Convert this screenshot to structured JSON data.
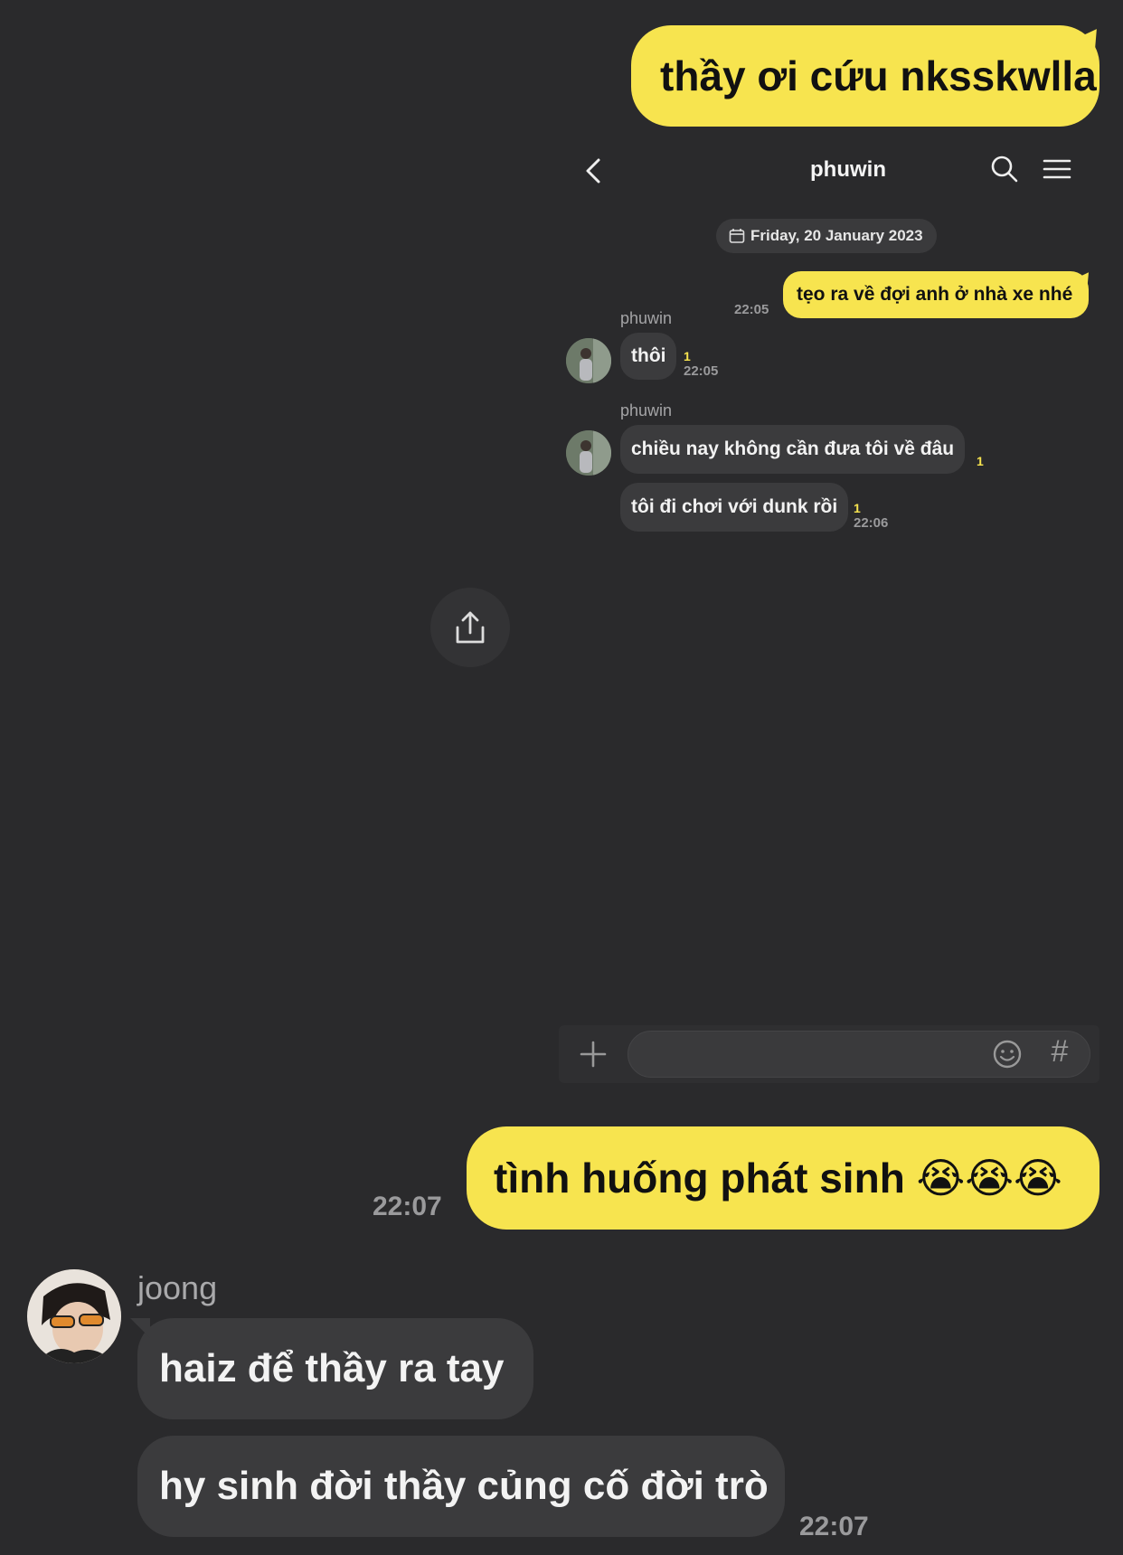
{
  "outer_chat": {
    "top_message": "thầy ơi cứu nksskwlla",
    "second_message": "tình huống phát sinh 😭😭😭",
    "second_message_time": "22:07",
    "reply_sender": "joong",
    "reply_1": "haiz để thầy ra tay",
    "reply_2": "hy sinh đời thầy củng cố đời trò",
    "reply_time": "22:07"
  },
  "inner_chat": {
    "title": "phuwin",
    "date": "Friday, 20 January 2023",
    "msg_me": "tẹo ra về đợi anh ở nhà xe nhé",
    "msg_me_time": "22:05",
    "sender_1": "phuwin",
    "msg_1": "thôi",
    "msg_1_unread": "1",
    "msg_1_time": "22:05",
    "sender_2": "phuwin",
    "msg_2": "chiều nay không cần đưa tôi về đâu",
    "msg_2_unread": "1",
    "msg_3": "tôi đi chơi với dunk rồi",
    "msg_3_unread": "1",
    "msg_3_time": "22:06",
    "input_hashtag": "#"
  },
  "colors": {
    "background": "#2a2a2c",
    "my_bubble": "#f7e44f",
    "other_bubble": "#3b3b3d"
  },
  "icons": [
    "back-arrow-icon",
    "search-icon",
    "menu-icon",
    "calendar-icon",
    "share-icon",
    "plus-icon",
    "emoji-icon",
    "hashtag-icon"
  ]
}
